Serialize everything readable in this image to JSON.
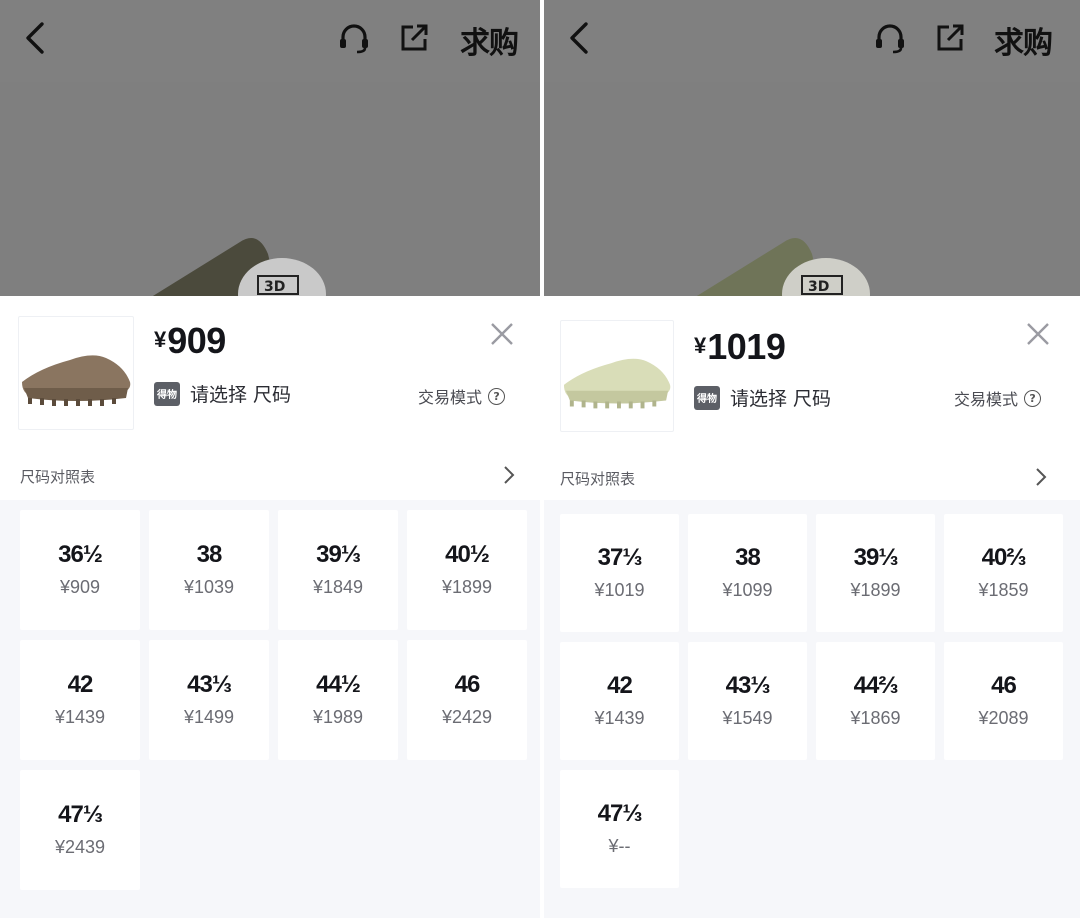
{
  "panels": [
    {
      "want_label": "求购",
      "price_symbol": "¥",
      "price": "909",
      "badge_text": "得物",
      "select_text": "请选择 尺码",
      "trade_mode": "交易模式",
      "help_glyph": "?",
      "size_chart": "尺码对照表",
      "shoe_color": "#8a7560",
      "sizes": [
        {
          "size": "36½",
          "price": "¥909"
        },
        {
          "size": "38",
          "price": "¥1039"
        },
        {
          "size": "39⅓",
          "price": "¥1849"
        },
        {
          "size": "40½",
          "price": "¥1899"
        },
        {
          "size": "42",
          "price": "¥1439"
        },
        {
          "size": "43⅓",
          "price": "¥1499"
        },
        {
          "size": "44½",
          "price": "¥1989"
        },
        {
          "size": "46",
          "price": "¥2429"
        },
        {
          "size": "47⅓",
          "price": "¥2439"
        }
      ]
    },
    {
      "want_label": "求购",
      "price_symbol": "¥",
      "price": "1019",
      "badge_text": "得物",
      "select_text": "请选择 尺码",
      "trade_mode": "交易模式",
      "help_glyph": "?",
      "size_chart": "尺码对照表",
      "shoe_color": "#d9ddb8",
      "sizes": [
        {
          "size": "37⅓",
          "price": "¥1019"
        },
        {
          "size": "38",
          "price": "¥1099"
        },
        {
          "size": "39⅓",
          "price": "¥1899"
        },
        {
          "size": "40⅔",
          "price": "¥1859"
        },
        {
          "size": "42",
          "price": "¥1439"
        },
        {
          "size": "43⅓",
          "price": "¥1549"
        },
        {
          "size": "44⅔",
          "price": "¥1869"
        },
        {
          "size": "46",
          "price": "¥2089"
        },
        {
          "size": "47⅓",
          "price": "¥--"
        }
      ]
    }
  ],
  "icons": {
    "back": "chevron-left-icon",
    "service": "headset-icon",
    "share": "share-icon",
    "close": "close-icon",
    "help": "help-circle-icon",
    "chart_arrow": "chevron-right-icon"
  },
  "colors": {
    "overlay": "#7f7f7f",
    "grid_background": "#f6f7fa",
    "badge": "#5c5f66"
  }
}
